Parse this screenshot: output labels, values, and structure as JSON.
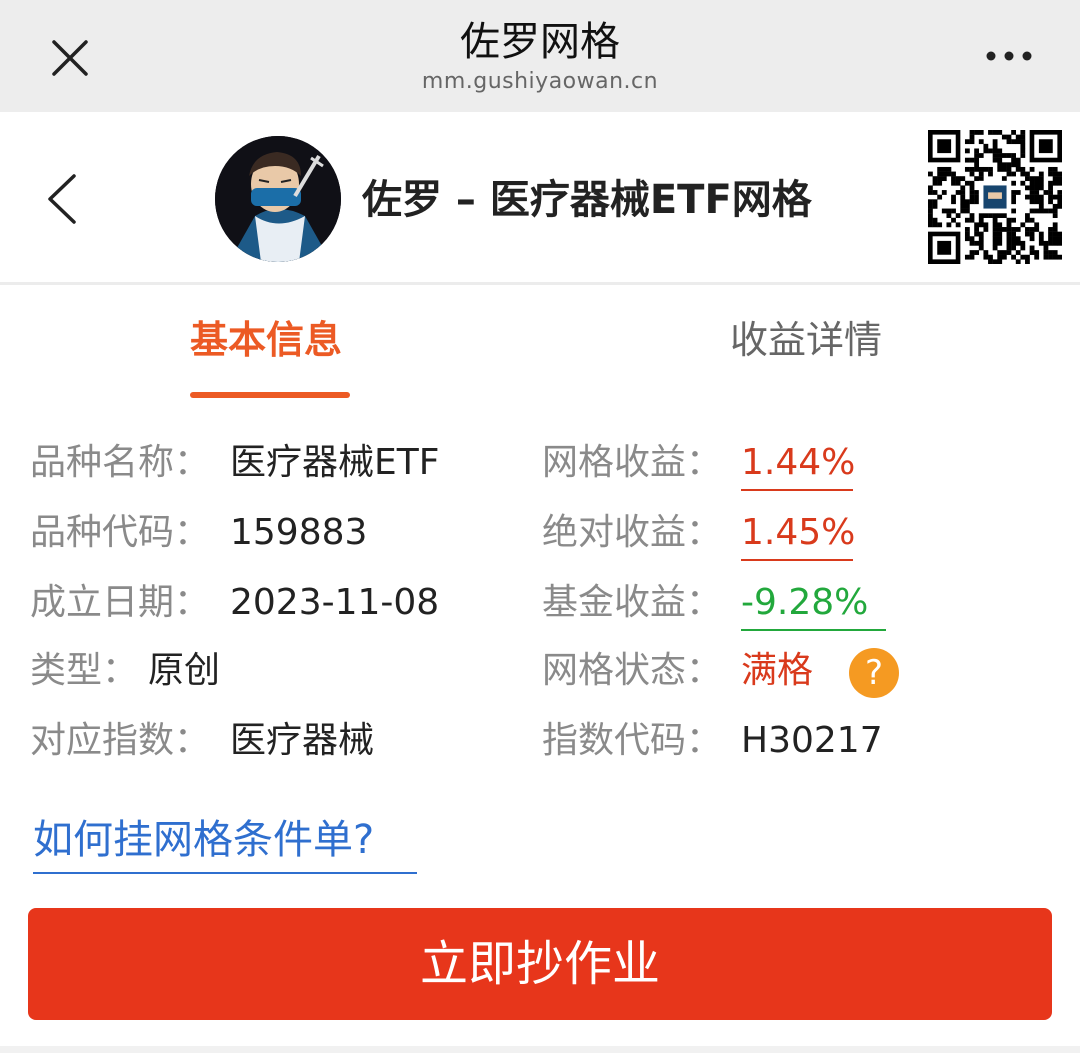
{
  "topbar": {
    "title": "佐罗网格",
    "url": "mm.gushiyaowan.cn"
  },
  "header": {
    "title": "佐罗 – 医疗器械ETF网格"
  },
  "tabs": [
    {
      "label": "基本信息",
      "active": true
    },
    {
      "label": "收益详情",
      "active": false
    }
  ],
  "info_left": [
    {
      "label": "品种名称：",
      "value": "医疗器械ETF"
    },
    {
      "label": "品种代码：",
      "value": "159883"
    },
    {
      "label": "成立日期：",
      "value": "2023-11-08"
    },
    {
      "label": "类型：",
      "value": "原创"
    },
    {
      "label": "对应指数：",
      "value": "医疗器械"
    }
  ],
  "info_right": [
    {
      "label": "网格收益：",
      "value": "1.44%"
    },
    {
      "label": "绝对收益：",
      "value": "1.45%"
    },
    {
      "label": "基金收益：",
      "value": "-9.28%"
    },
    {
      "label": "网格状态：",
      "value": "满格"
    },
    {
      "label": "指数代码：",
      "value": "H30217"
    }
  ],
  "help_mark": "?",
  "howto_link": "如何挂网格条件单?",
  "copy_button": "立即抄作业",
  "colors": {
    "accent_orange": "#ec5a24",
    "positive_red": "#d93a1c",
    "negative_green": "#22a83c",
    "link_blue": "#2f6fcf",
    "button_red": "#e7361b",
    "help_orange": "#f59a22"
  },
  "icons": [
    "close-icon",
    "more-icon",
    "back-icon",
    "avatar",
    "qr-code",
    "help-icon"
  ]
}
